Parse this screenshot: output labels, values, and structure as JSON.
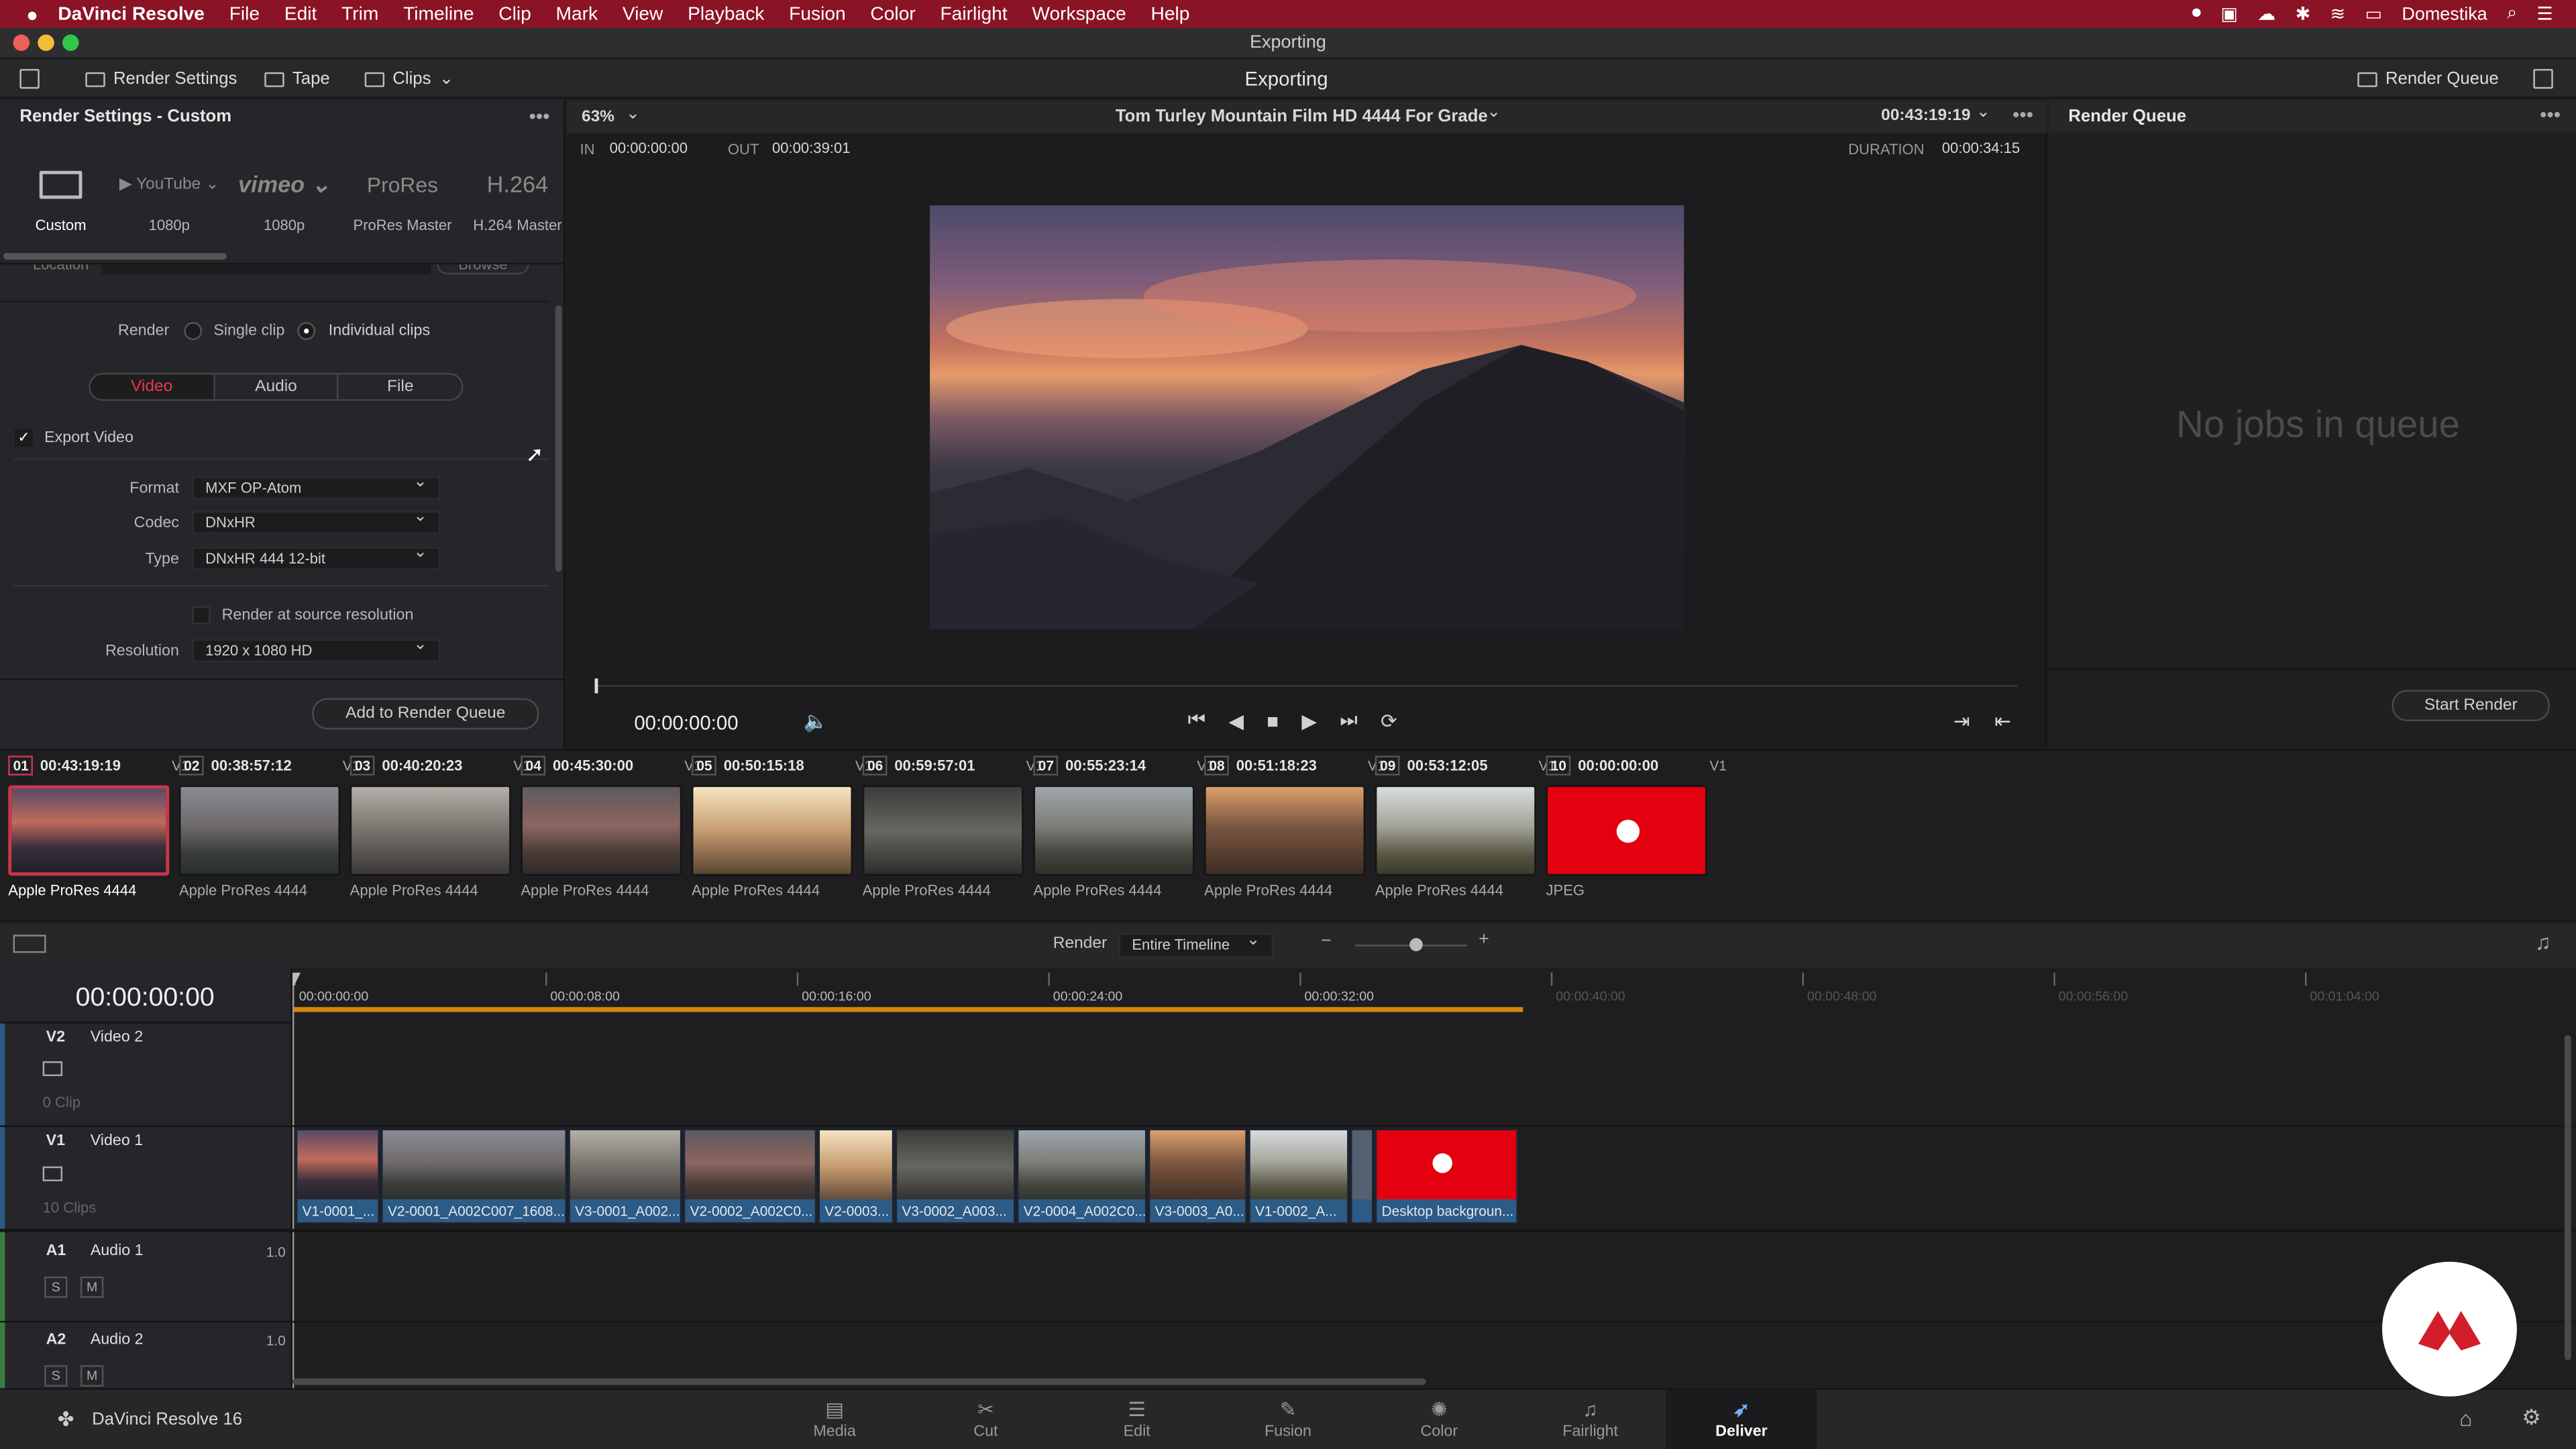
{
  "menubar": {
    "apple": "",
    "app": "DaVinci Resolve",
    "items": [
      "File",
      "Edit",
      "Trim",
      "Timeline",
      "Clip",
      "Mark",
      "View",
      "Playback",
      "Fusion",
      "Color",
      "Fairlight",
      "Workspace",
      "Help"
    ],
    "user": "Domestika"
  },
  "window": {
    "title": "Exporting"
  },
  "toolbar": {
    "render_settings": "Render Settings",
    "tape": "Tape",
    "clips": "Clips",
    "center_title": "Exporting",
    "render_queue": "Render Queue"
  },
  "render_settings": {
    "title": "Render Settings - Custom",
    "presets": [
      {
        "logo": "▭",
        "label": "Custom"
      },
      {
        "logo": "▶ YouTube ⌄",
        "label": "1080p"
      },
      {
        "logo": "vimeo ⌄",
        "label": "1080p"
      },
      {
        "logo": "ProRes",
        "label": "ProRes Master"
      },
      {
        "logo": "H.264",
        "label": "H.264 Master"
      }
    ],
    "location": "Location",
    "browse": "Browse",
    "render_label": "Render",
    "single_clip": "Single clip",
    "individual_clips": "Individual clips",
    "tabs": [
      "Video",
      "Audio",
      "File"
    ],
    "export_video": "Export Video",
    "format_label": "Format",
    "format_value": "MXF OP-Atom",
    "codec_label": "Codec",
    "codec_value": "DNxHR",
    "type_label": "Type",
    "type_value": "DNxHR 444 12-bit",
    "source_res": "Render at source resolution",
    "resolution_label": "Resolution",
    "resolution_value": "1920 x 1080 HD",
    "add_to_queue": "Add to Render Queue"
  },
  "viewer": {
    "zoom": "63%",
    "clip_title": "Tom Turley Mountain Film HD 4444 For Grade",
    "timecode_top": "00:43:19:19",
    "in_label": "IN",
    "in_value": "00:00:00:00",
    "out_label": "OUT",
    "out_value": "00:00:39:01",
    "duration_label": "DURATION",
    "duration_value": "00:00:34:15",
    "playhead_tc": "00:00:00:00"
  },
  "render_queue": {
    "title": "Render Queue",
    "empty": "No jobs in queue",
    "start": "Start Render"
  },
  "clips": [
    {
      "num": "01",
      "tc": "00:43:19:19",
      "track": "V1",
      "codec": "Apple ProRes 4444"
    },
    {
      "num": "02",
      "tc": "00:38:57:12",
      "track": "V1",
      "codec": "Apple ProRes 4444"
    },
    {
      "num": "03",
      "tc": "00:40:20:23",
      "track": "V1",
      "codec": "Apple ProRes 4444"
    },
    {
      "num": "04",
      "tc": "00:45:30:00",
      "track": "V1",
      "codec": "Apple ProRes 4444"
    },
    {
      "num": "05",
      "tc": "00:50:15:18",
      "track": "V1",
      "codec": "Apple ProRes 4444"
    },
    {
      "num": "06",
      "tc": "00:59:57:01",
      "track": "V1",
      "codec": "Apple ProRes 4444"
    },
    {
      "num": "07",
      "tc": "00:55:23:14",
      "track": "V1",
      "codec": "Apple ProRes 4444"
    },
    {
      "num": "08",
      "tc": "00:51:18:23",
      "track": "V1",
      "codec": "Apple ProRes 4444"
    },
    {
      "num": "09",
      "tc": "00:53:12:05",
      "track": "V1",
      "codec": "Apple ProRes 4444"
    },
    {
      "num": "10",
      "tc": "00:00:00:00",
      "track": "V1",
      "codec": "JPEG"
    }
  ],
  "timeline_bar": {
    "render_label": "Render",
    "render_value": "Entire Timeline"
  },
  "timeline": {
    "timecode": "00:00:00:00",
    "ruler": [
      "00:00:00:00",
      "00:00:08:00",
      "00:00:16:00",
      "00:00:24:00",
      "00:00:32:00",
      "00:00:40:00",
      "00:00:48:00",
      "00:00:56:00",
      "00:01:04:00"
    ],
    "tracks": [
      {
        "id": "V2",
        "name": "Video 2",
        "count": "0 Clip"
      },
      {
        "id": "V1",
        "name": "Video 1",
        "count": "10 Clips"
      },
      {
        "id": "A1",
        "name": "Audio 1",
        "level": "1.0"
      },
      {
        "id": "A2",
        "name": "Audio 2",
        "level": "1.0"
      }
    ],
    "solo": "S",
    "mute": "M",
    "clips": [
      "V1-0001_...",
      "V2-0001_A002C007_1608...",
      "V3-0001_A002...",
      "V2-0002_A002C0...",
      "V2-0003...",
      "V3-0002_A003...",
      "V2-0004_A002C0...",
      "V3-0003_A0...",
      "V1-0002_A...",
      "",
      "Desktop backgroun..."
    ]
  },
  "footer": {
    "app_name": "DaVinci Resolve 16",
    "pages": [
      "Media",
      "Cut",
      "Edit",
      "Fusion",
      "Color",
      "Fairlight",
      "Deliver"
    ]
  },
  "colors": {
    "accent": "#e8384c",
    "menubar": "#8b1326",
    "timeline_clip": "#2c5b85"
  }
}
